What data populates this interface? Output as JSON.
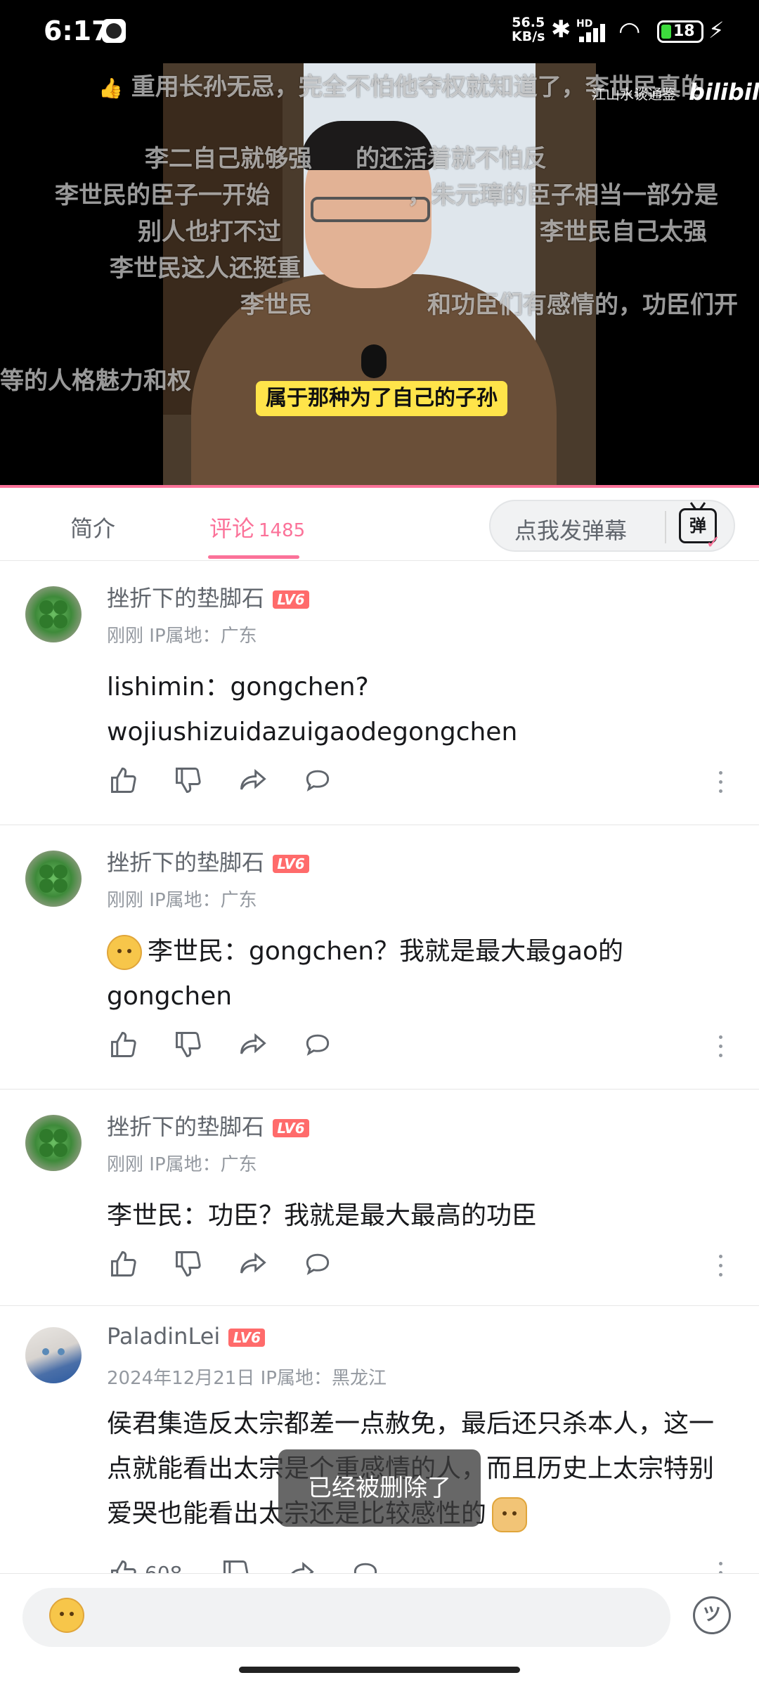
{
  "status_bar": {
    "time": "6:17",
    "net_speed_value": "56.5",
    "net_speed_unit": "KB/s",
    "hd": "HD",
    "battery": "18"
  },
  "video": {
    "caption": "属于那种为了自己的子孙",
    "watermark": "江山水谈通鉴",
    "logo": "bilibili",
    "danmaku": [
      "重用长孙无忌，完全不怕他夺权就知道了，李世民真的",
      "李二自己就够强",
      "的还活着就不怕反",
      "李世民的臣子一开始",
      "，朱元璋的臣子相当一部分是",
      "别人也打不过",
      "李世民自己太强",
      "李世民这人还挺重",
      "李世民",
      "和功臣们有感情的，功臣们开",
      "等的人格魅力和权"
    ]
  },
  "tabs": {
    "intro": "简介",
    "comments": "评论",
    "comments_count": "1485",
    "danmaku_button": "点我发弹幕",
    "danmaku_icon_glyph": "弹"
  },
  "comments": [
    {
      "user": "挫折下的垫脚石",
      "level": "LV6",
      "time": "刚刚",
      "ip": "IP属地：广东",
      "text": "lishimin：gongchen?\nwojiushizuidazuigaodegongchen",
      "likes": ""
    },
    {
      "user": "挫折下的垫脚石",
      "level": "LV6",
      "time": "刚刚",
      "ip": "IP属地：广东",
      "text": "李世民：gongchen？我就是最大最gao的gongchen",
      "likes": ""
    },
    {
      "user": "挫折下的垫脚石",
      "level": "LV6",
      "time": "刚刚",
      "ip": "IP属地：广东",
      "text": "李世民：功臣？我就是最大最高的功臣",
      "likes": ""
    },
    {
      "user": "PaladinLei",
      "level": "LV6",
      "time": "2024年12月21日",
      "ip": "IP属地：黑龙江",
      "text": "侯君集造反太宗都差一点赦免，最后还只杀本人，这一点就能看出太宗是个重感情的人，而且历史上太宗特别爱哭也能看出太宗还是比较感性的",
      "likes": "608"
    }
  ],
  "toast": "已经被删除了",
  "colors": {
    "accent": "#fb7299",
    "level_badge": "#ff6b6b",
    "caption_bg": "#ffe44a"
  },
  "icons": [
    "like-icon",
    "dislike-icon",
    "share-icon",
    "reply-icon",
    "more-icon",
    "emoji-icon",
    "danmaku-icon"
  ]
}
